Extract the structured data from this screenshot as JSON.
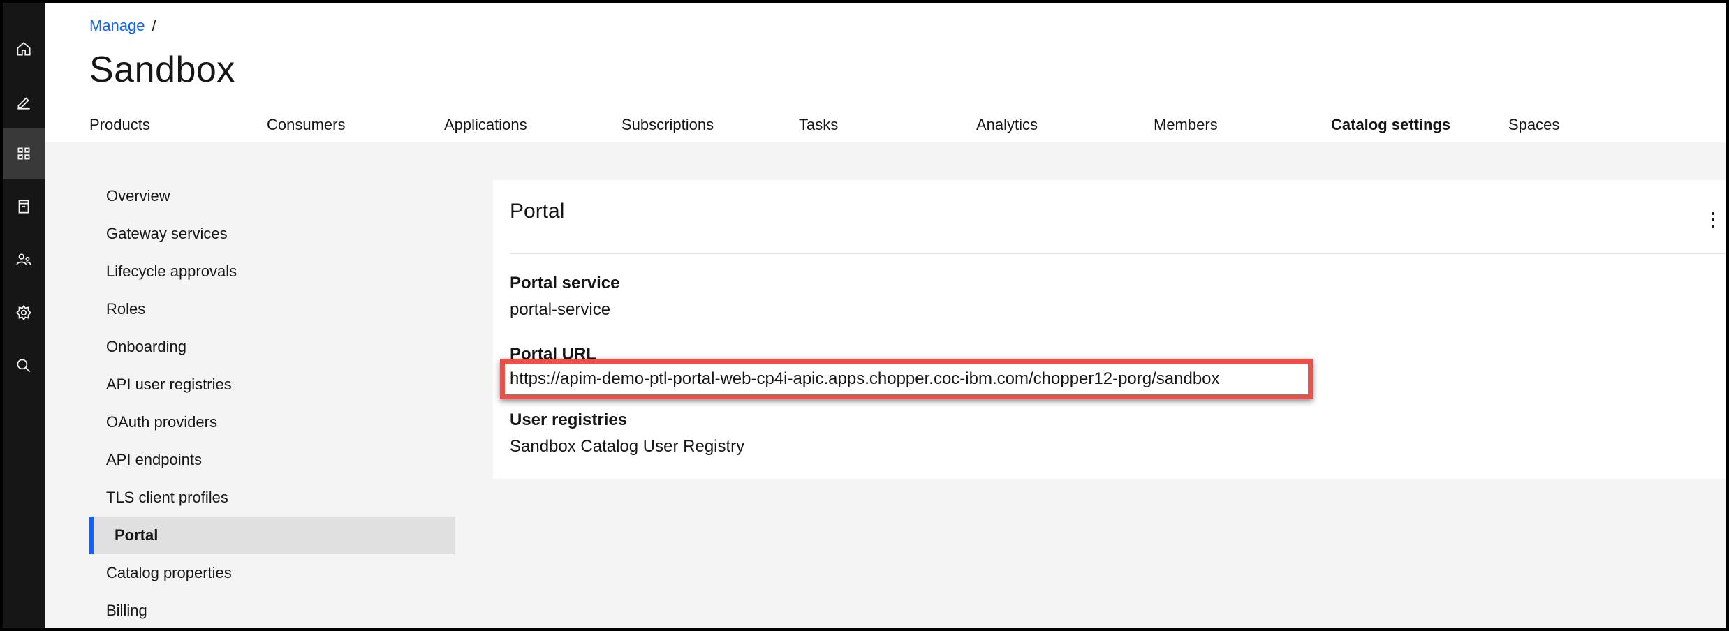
{
  "rail": {
    "icons": [
      "home-icon",
      "edit-icon",
      "manage-icon",
      "archive-icon",
      "members-icon",
      "settings-icon",
      "search-icon"
    ]
  },
  "breadcrumb": {
    "link": "Manage",
    "separator": "/"
  },
  "page_title": "Sandbox",
  "tabs": [
    {
      "label": "Products"
    },
    {
      "label": "Consumers"
    },
    {
      "label": "Applications"
    },
    {
      "label": "Subscriptions"
    },
    {
      "label": "Tasks"
    },
    {
      "label": "Analytics"
    },
    {
      "label": "Members"
    },
    {
      "label": "Catalog settings"
    },
    {
      "label": "Spaces"
    }
  ],
  "active_tab": "Catalog settings",
  "side_nav": [
    {
      "label": "Overview"
    },
    {
      "label": "Gateway services"
    },
    {
      "label": "Lifecycle approvals"
    },
    {
      "label": "Roles"
    },
    {
      "label": "Onboarding"
    },
    {
      "label": "API user registries"
    },
    {
      "label": "OAuth providers"
    },
    {
      "label": "API endpoints"
    },
    {
      "label": "TLS client profiles"
    },
    {
      "label": "Portal"
    },
    {
      "label": "Catalog properties"
    },
    {
      "label": "Billing"
    }
  ],
  "active_side_item": "Portal",
  "card": {
    "title": "Portal",
    "portal_service_label": "Portal service",
    "portal_service_value": "portal-service",
    "portal_url_label": "Portal URL",
    "portal_url_value": "https://apim-demo-ptl-portal-web-cp4i-apic.apps.chopper.coc-ibm.com/chopper12-porg/sandbox",
    "user_registries_label": "User registries",
    "user_registries_value": "Sandbox Catalog User Registry"
  },
  "colors": {
    "accent": "#0f62fe",
    "rail": "#161616",
    "highlight_border": "#e8524a",
    "background": "#f4f4f4"
  }
}
